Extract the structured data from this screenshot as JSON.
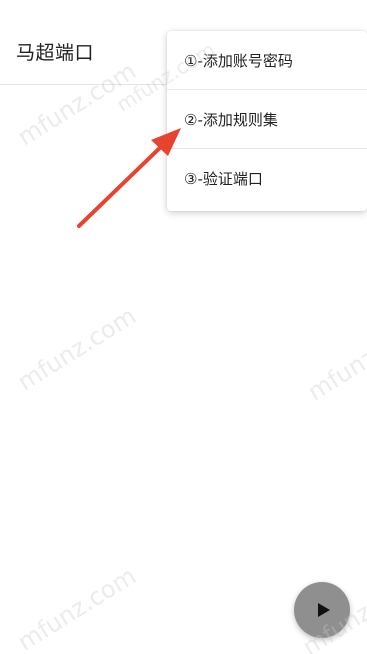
{
  "appbar": {
    "title": "马超端口"
  },
  "menu": {
    "items": [
      {
        "label": "①-添加账号密码"
      },
      {
        "label": "②-添加规则集"
      },
      {
        "label": "③-验证端口"
      }
    ]
  },
  "fab": {
    "icon": "play-icon"
  },
  "watermark": {
    "text": "mfunz.com"
  },
  "annotation": {
    "color": "#e8432f"
  }
}
